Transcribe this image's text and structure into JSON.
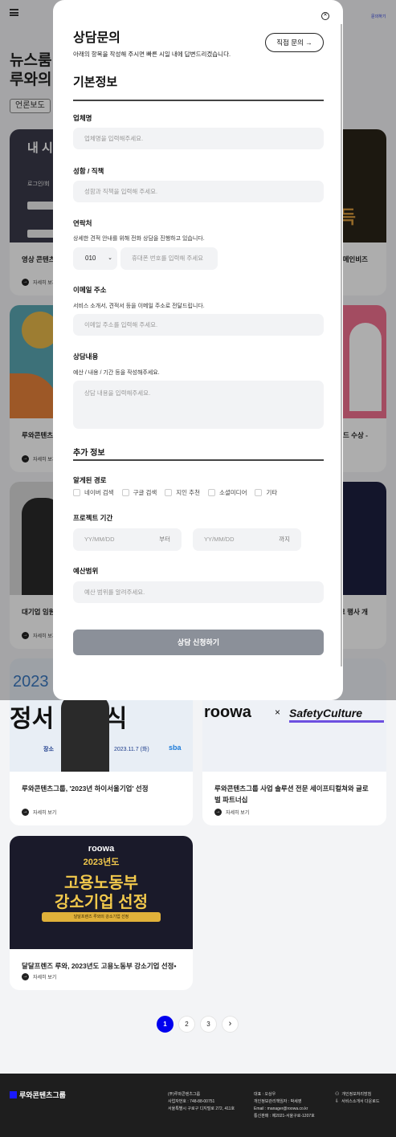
{
  "topbar": {
    "link": "문의하기"
  },
  "page": {
    "title": "뉴스룸",
    "subtitle": "루와의 소",
    "chip": "언론보도"
  },
  "cards": [
    {
      "title": "영상 콘텐츠… 파이' 3월 출…",
      "more": "자세히 보기",
      "thumb_text": "내 시",
      "thumb_sub": "로그인/회",
      "right_title": "메인비즈",
      "right_thumb": "득"
    },
    {
      "title": "루와콘텐츠… 업 선정",
      "more": "자세히 보기",
      "right_title": "드 수상 -"
    },
    {
      "title": "대기업 임원… 안 해\"",
      "more": "자세히 보기",
      "right_title": "크 행사 개"
    },
    {
      "title": "루와콘텐츠그룹, '2023년 하이서울기업' 선정",
      "more": "자세히 보기",
      "thumb_year": "2023",
      "thumb_text": "정서 전달식",
      "thumb_date": "2023.11.7 (화)",
      "thumb_place": "장소",
      "thumb_brand": "sba"
    },
    {
      "title": "루와콘텐츠그룹 사업 솔루션 전문 세이프티컬쳐와 글로벌 파트너십",
      "more": "자세히 보기",
      "brand1": "roowa",
      "times": "×",
      "brand2": "SafetyCulture"
    },
    {
      "title": "달달프렌즈 루와, 2023년도 고용노동부 강소기업 선정•",
      "more": "자세히 보기",
      "logo": "roowa",
      "year": "2023년도",
      "line1": "고용노동부",
      "line2": "강소기업 선정",
      "ribbon": "달달프렌즈 루와의 강소기업 선정"
    }
  ],
  "modal": {
    "title": "상담문의",
    "desc": "아래의 항목을 작성해 주시면 빠른 시일 내에 답변드리겠습니다.",
    "direct_button": "직접 문의",
    "direct_arrow": "→",
    "close": "✕",
    "section_basic": "기본정보",
    "company_label": "업체명",
    "company_placeholder": "업체명을 입력해주세요.",
    "name_label": "성함 / 직책",
    "name_placeholder": "성함과 직책을 입력해 주세요.",
    "contact_label": "연락처",
    "contact_hint": "상세한 견적 안내를 위해 전화 상담을 진행하고 있습니다.",
    "phone_prefix": "010",
    "phone_placeholder": "휴대폰 번호를 입력해 주세요",
    "email_label": "이메일 주소",
    "email_hint": "서비스 소개서, 견적서 등을 이메일 주소로 전달드립니다.",
    "email_placeholder": "이메일 주소를 입력해 주세요.",
    "inquiry_label": "상담내용",
    "inquiry_hint": "예산 / 내용 / 기간 등을 작성해주세요.",
    "inquiry_placeholder": "상담 내용을 입력해주세요.",
    "section_extra": "추가 정보",
    "source_label": "알게된 경로",
    "sources": [
      "네이버 검색",
      "구글 검색",
      "지인 추천",
      "소셜미디어",
      "기타"
    ],
    "period_label": "프로젝트 기간",
    "date_placeholder": "YY/MM/DD",
    "from": "부터",
    "to": "까지",
    "budget_label": "예산범위",
    "budget_placeholder": "예산 범위를 알려주세요.",
    "submit": "상담 신청하기"
  },
  "pagination": {
    "pages": [
      "1",
      "2",
      "3"
    ],
    "next": "›",
    "current": 1
  },
  "footer": {
    "logo": "루와콘텐츠그룹",
    "col1": [
      "(주)루와콘텐츠그룹",
      "사업자번호 : 748-88-00751",
      "서울특별시 구로구 디지털로 272, 411호"
    ],
    "col2": [
      "대표 : 오상우",
      "개인정보관리책임자 : 박세영",
      "Email : manager@roowa.co.kr",
      "통신판매 : 제2021-서울구로-1207호"
    ],
    "links": [
      "개인정보처리방침",
      "서비스소개서 다운로드"
    ]
  }
}
